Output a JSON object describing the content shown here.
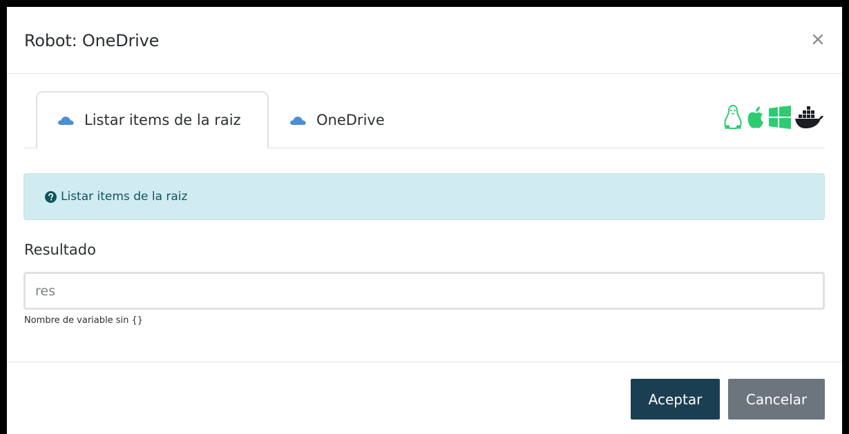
{
  "modal": {
    "title": "Robot: OneDrive",
    "close_icon": "close-icon"
  },
  "tabs": [
    {
      "label": "Listar items de la raiz",
      "icon": "onedrive-cloud-icon",
      "active": true
    },
    {
      "label": "OneDrive",
      "icon": "onedrive-cloud-icon",
      "active": false
    }
  ],
  "os_icons": [
    "linux-icon",
    "apple-icon",
    "windows-icon",
    "docker-icon"
  ],
  "colors": {
    "os_icon_green": "#2ecc71",
    "cloud_blue": "#4a8fd6",
    "alert_bg": "#d1ecf1",
    "alert_text": "#0c5460",
    "accept_bg": "#1b3f52",
    "cancel_bg": "#6c757d"
  },
  "info": {
    "text": "Listar items de la raiz",
    "icon": "question-circle-icon"
  },
  "form": {
    "result_label": "Resultado",
    "result_placeholder": "res",
    "result_value": "",
    "help_text": "Nombre de variable sin {}"
  },
  "footer": {
    "accept_label": "Aceptar",
    "cancel_label": "Cancelar"
  }
}
